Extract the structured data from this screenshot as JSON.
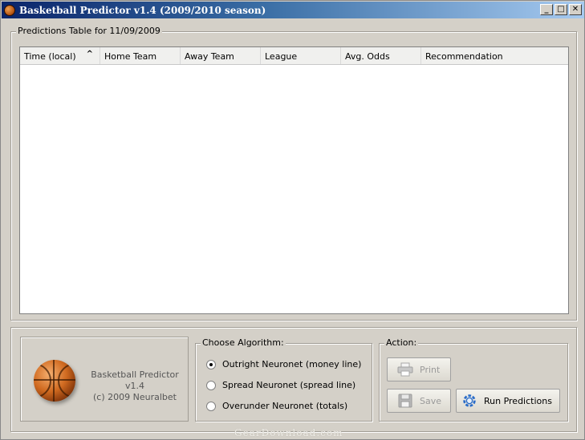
{
  "window": {
    "title": "Basketball Predictor v1.4 (2009/2010 season)",
    "controls": {
      "minimize": "_",
      "maximize": "□",
      "close": "✕"
    }
  },
  "predictions": {
    "group_title": "Predictions Table for 11/09/2009",
    "columns": [
      "Time (local)",
      "Home Team",
      "Away Team",
      "League",
      "Avg. Odds",
      "Recommendation"
    ],
    "sort_indicator": "^",
    "rows": []
  },
  "logo": {
    "line1": "Basketball Predictor v1.4",
    "line2": "(c) 2009 Neuralbet"
  },
  "algorithm": {
    "group_title": "Choose Algorithm:",
    "options": [
      {
        "label": "Outright Neuronet  (money line)",
        "selected": true
      },
      {
        "label": "Spread Neuronet  (spread line)",
        "selected": false
      },
      {
        "label": "Overunder Neuronet  (totals)",
        "selected": false
      }
    ]
  },
  "action": {
    "group_title": "Action:",
    "print_label": "Print",
    "save_label": "Save",
    "run_label": "Run Predictions",
    "print_icon": "printer-icon",
    "save_icon": "floppy-disk-icon",
    "run_icon": "gear-icon"
  },
  "watermark": "GearDownload.com"
}
